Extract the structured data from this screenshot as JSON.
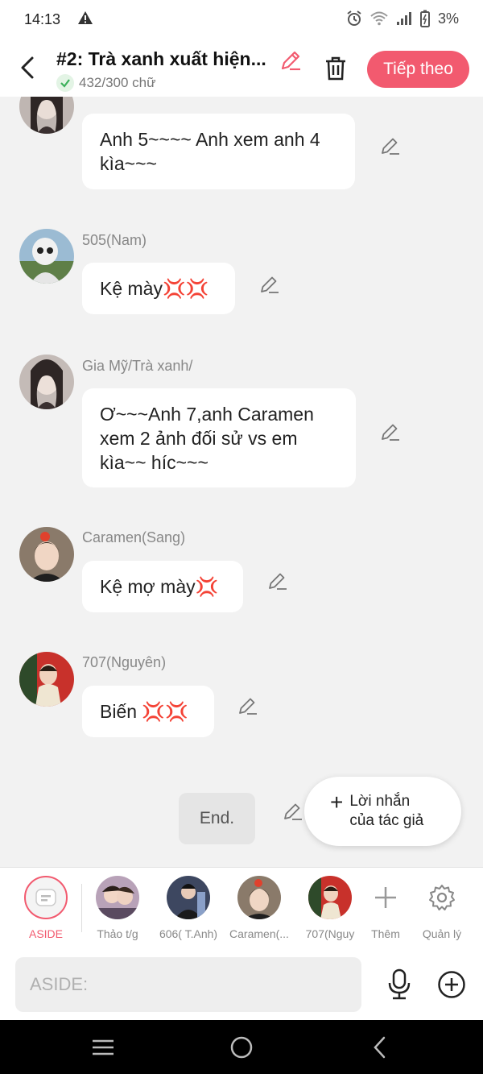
{
  "status": {
    "time": "14:13",
    "battery": "3%"
  },
  "header": {
    "title": "#2: Trà xanh xuất hiện...",
    "word_count": "432/300 chữ",
    "next_label": "Tiếp theo"
  },
  "messages": [
    {
      "name": "",
      "text": "Anh 5~~~~ Anh xem anh 4 kìa~~~"
    },
    {
      "name": "505(Nam)",
      "text": "Kệ mày💢💢"
    },
    {
      "name": "Gia Mỹ/Trà xanh/",
      "text": "Ơ~~~Anh 7,anh Caramen xem 2 ảnh đối sử vs em kìa~~ híc~~~"
    },
    {
      "name": "Caramen(Sang)",
      "text": "Kệ mợ mày💢"
    },
    {
      "name": "707(Nguyên)",
      "text": "Biến 💢💢"
    }
  ],
  "end_label": "End.",
  "author_message": {
    "line1": "Lời nhắn",
    "line2": "của tác giả"
  },
  "characters": [
    {
      "label": "ASIDE"
    },
    {
      "label": "Thảo t/g"
    },
    {
      "label": "606( T.Anh)"
    },
    {
      "label": "Caramen(..."
    },
    {
      "label": "707(Nguy"
    }
  ],
  "more_label": "Thêm",
  "manage_label": "Quản lý",
  "input": {
    "placeholder": "ASIDE:"
  },
  "colors": {
    "accent": "#f25a6f",
    "background": "#f2f2f2",
    "bubble": "#ffffff"
  }
}
